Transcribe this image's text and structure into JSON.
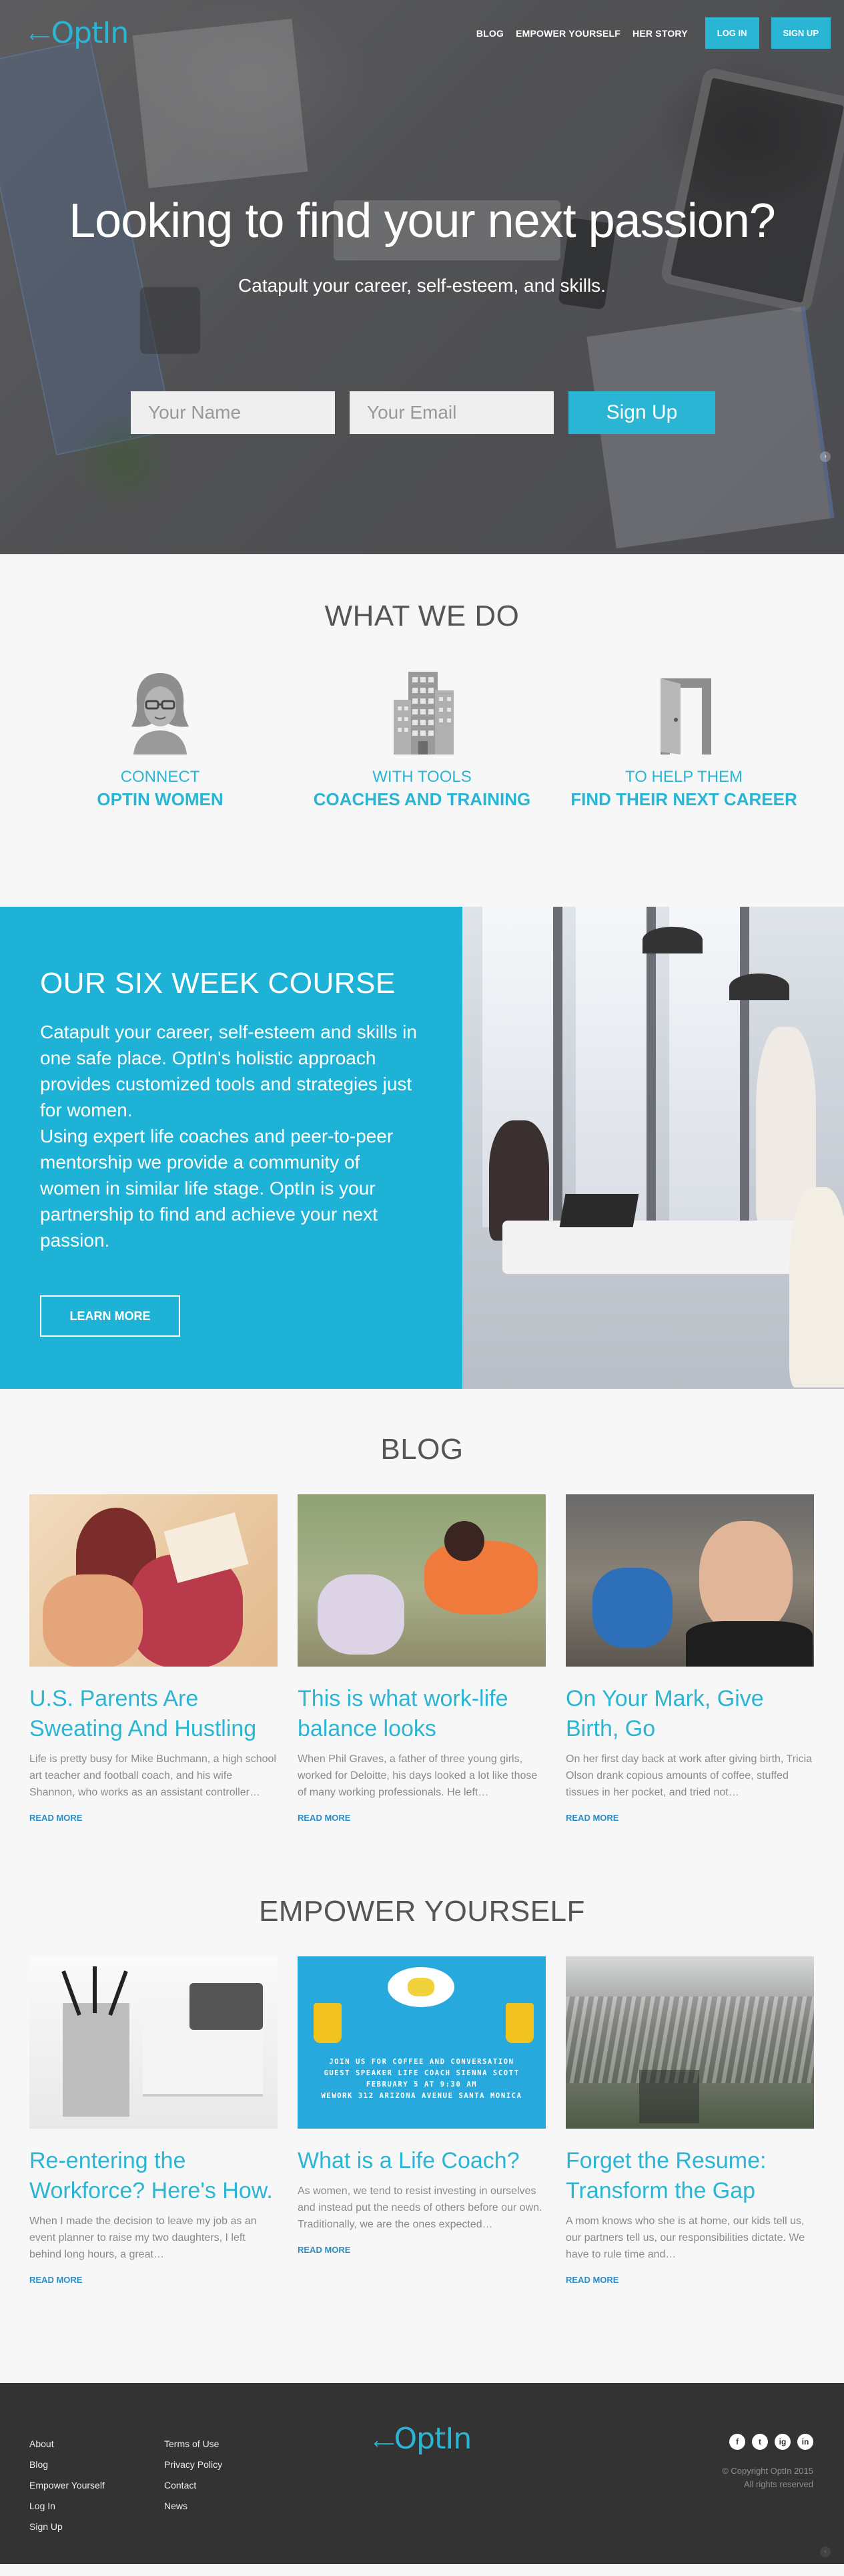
{
  "nav": {
    "logo": "OptIn",
    "links": [
      "BLOG",
      "EMPOWER YOURSELF",
      "HER STORY"
    ],
    "login": "LOG IN",
    "signup": "SIGN UP"
  },
  "hero": {
    "title": "Looking to find your next passion?",
    "subtitle": "Catapult your career, self-esteem, and skills.",
    "name_placeholder": "Your Name",
    "email_placeholder": "Your Email",
    "submit": "Sign Up"
  },
  "what_we_do": {
    "title": "WHAT WE DO",
    "features": [
      {
        "icon": "woman-icon",
        "line1": "CONNECT",
        "line2": "OPTIN WOMEN"
      },
      {
        "icon": "building-icon",
        "line1": "WITH TOOLS",
        "line2": "COACHES AND TRAINING"
      },
      {
        "icon": "door-icon",
        "line1": "TO HELP THEM",
        "line2": "FIND THEIR NEXT CAREER"
      }
    ]
  },
  "course": {
    "title": "OUR SIX WEEK COURSE",
    "para1": "Catapult your career, self-esteem and skills in one safe place. OptIn's holistic approach provides customized tools and strategies just for women.",
    "para2": "Using expert life coaches and peer-to-peer mentorship we provide a community of women in similar life stage. OptIn is your partnership to find and achieve your next passion.",
    "button": "LEARN MORE"
  },
  "blog": {
    "title": "BLOG",
    "posts": [
      {
        "title": "U.S. Parents Are Sweating And Hustling",
        "excerpt": "Life is pretty busy for Mike Buchmann, a high school art teacher and football coach, and his wife Shannon, who works as an assistant controller…",
        "more": "READ MORE"
      },
      {
        "title": "This is what work-life balance looks",
        "excerpt": "When Phil Graves, a father of three young girls, worked for Deloitte, his days looked a lot like those of many working professionals. He left…",
        "more": "READ MORE"
      },
      {
        "title": "On Your Mark, Give Birth, Go",
        "excerpt": "On her first day back at work after giving birth, Tricia Olson drank copious amounts of coffee, stuffed tissues in her pocket, and tried not…",
        "more": "READ MORE"
      }
    ]
  },
  "empower": {
    "title": "EMPOWER YOURSELF",
    "event_lines": [
      "JOIN US FOR COFFEE AND CONVERSATION",
      "GUEST SPEAKER LIFE COACH SIENNA SCOTT",
      "FEBRUARY 5 AT 9:30 AM",
      "WEWORK 312 ARIZONA AVENUE SANTA MONICA"
    ],
    "posts": [
      {
        "title": "Re-entering the Workforce? Here's How.",
        "excerpt": "When I made the decision to leave my job as an event planner to raise my two daughters, I left behind long hours, a great…",
        "more": "READ MORE"
      },
      {
        "title": "What is a Life Coach?",
        "excerpt": "As women, we tend to resist investing in ourselves and instead put the needs of others before our own. Traditionally, we are the ones expected…",
        "more": "READ MORE"
      },
      {
        "title": "Forget the Resume: Transform the Gap",
        "excerpt": "A mom knows who she is at home, our kids tell us, our partners tell us, our responsibilities dictate. We have to rule time and…",
        "more": "READ MORE"
      }
    ]
  },
  "footer": {
    "col1": [
      "About",
      "Blog",
      "Empower Yourself",
      "Log In",
      "Sign Up"
    ],
    "col2": [
      "Terms of Use",
      "Privacy Policy",
      "Contact",
      "News"
    ],
    "logo": "OptIn",
    "social": [
      "f",
      "t",
      "ig",
      "in"
    ],
    "copyright": "© Copyright OptIn 2015",
    "rights": "All rights reserved"
  },
  "colors": {
    "accent": "#2bb5d4",
    "course_bg": "#1db2d6",
    "footer_bg": "#333333",
    "link": "#2b8dc4"
  }
}
